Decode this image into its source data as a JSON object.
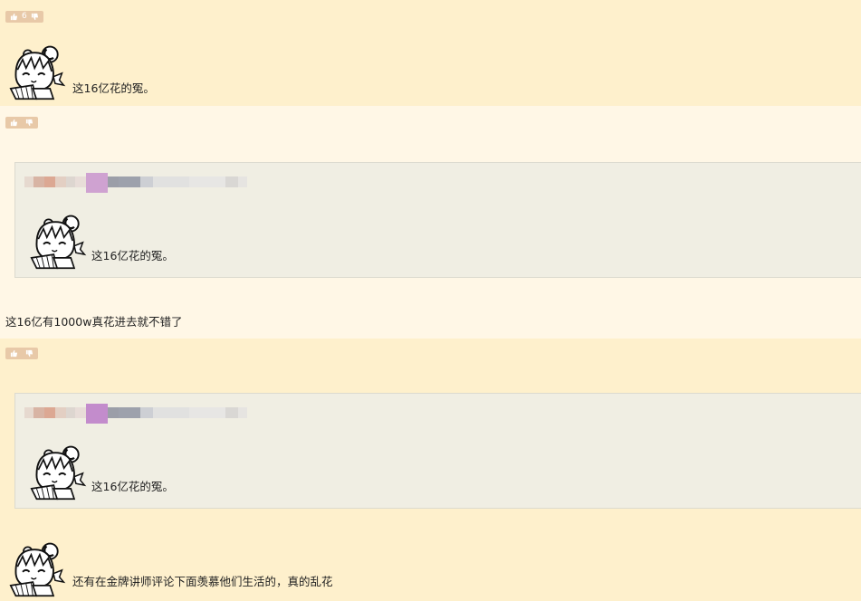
{
  "posts": [
    {
      "vote_count": "6",
      "caption": "这16亿花的冤。"
    },
    {
      "vote_count": "",
      "quote_caption": "这16亿花的冤。",
      "reply_text": "这16亿有1000w真花进去就不错了"
    },
    {
      "vote_count": "",
      "quote_caption": "这16亿花的冤。",
      "reply_text": "还有在金牌讲师评论下面羡慕他们生活的，真的乱花"
    }
  ],
  "icons": {
    "thumb_up": "thumb-up-icon",
    "thumb_down": "thumb-down-icon",
    "avatar": "anime-girl-fan-avatar"
  },
  "colors": {
    "post_bg_a": "#fef0cc",
    "post_bg_b": "#fff7e6",
    "quote_bg": "#f0eee3",
    "vote_bg": "#e8c9a8"
  }
}
